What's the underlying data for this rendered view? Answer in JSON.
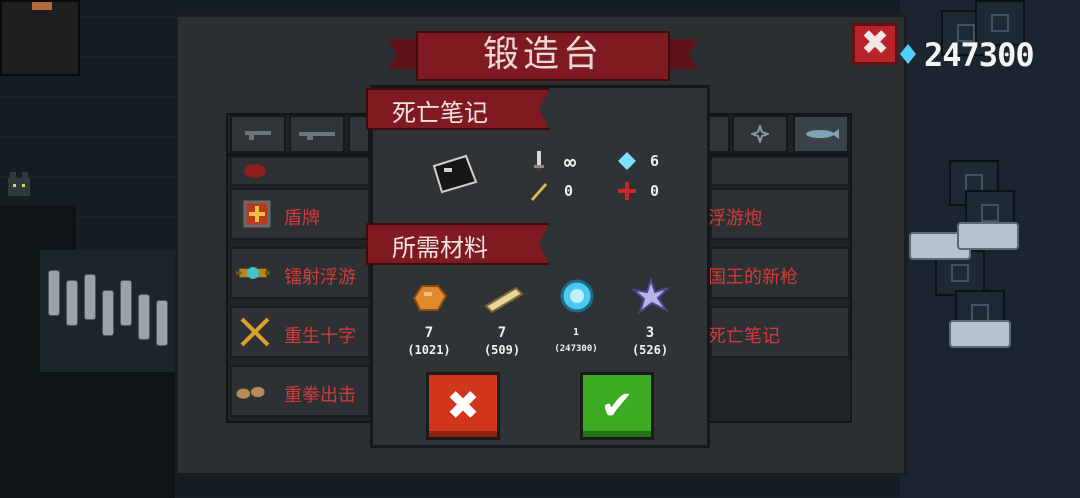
{
  "forge": {
    "title": "锻造台",
    "close_label": "✖",
    "coins": "247300",
    "tabs": [
      "pistol",
      "rifle",
      "",
      "",
      "",
      "",
      "",
      "shuriken",
      "fish"
    ],
    "list": {
      "left": [
        {
          "label": "",
          "icon": "shield-icon"
        },
        {
          "label": "盾牌",
          "icon": "shield-icon"
        },
        {
          "label": "镭射浮游",
          "icon": "drone-icon"
        },
        {
          "label": "重生十字",
          "icon": "crossbow-icon"
        },
        {
          "label": "重拳出击",
          "icon": "fist-icon"
        }
      ],
      "right": [
        {
          "label": "浮游炮"
        },
        {
          "label": "国王的新枪"
        },
        {
          "label": "死亡笔记"
        }
      ]
    }
  },
  "dialog": {
    "item_title": "死亡笔记",
    "weapon_icon": "death-note-icon",
    "stats": {
      "damage": "∞",
      "energy": "6",
      "crit": "0",
      "accuracy": "0"
    },
    "materials_title": "所需材料",
    "materials": [
      {
        "icon": "ore-icon",
        "count": "7",
        "stock": "(1021)"
      },
      {
        "icon": "wood-plank-icon",
        "count": "7",
        "stock": "(509)"
      },
      {
        "icon": "gem-coin-icon",
        "count": "1",
        "stock": "(247300)"
      },
      {
        "icon": "star-crystal-icon",
        "count": "3",
        "stock": "(526)"
      }
    ],
    "cancel_label": "✖",
    "confirm_label": "✔"
  },
  "colors": {
    "banner_red": "#7e1a20",
    "list_text_red": "#d33a3a",
    "cancel_orange": "#d0361c",
    "confirm_green": "#3caa22",
    "gem_cyan": "#4fd1ff"
  }
}
